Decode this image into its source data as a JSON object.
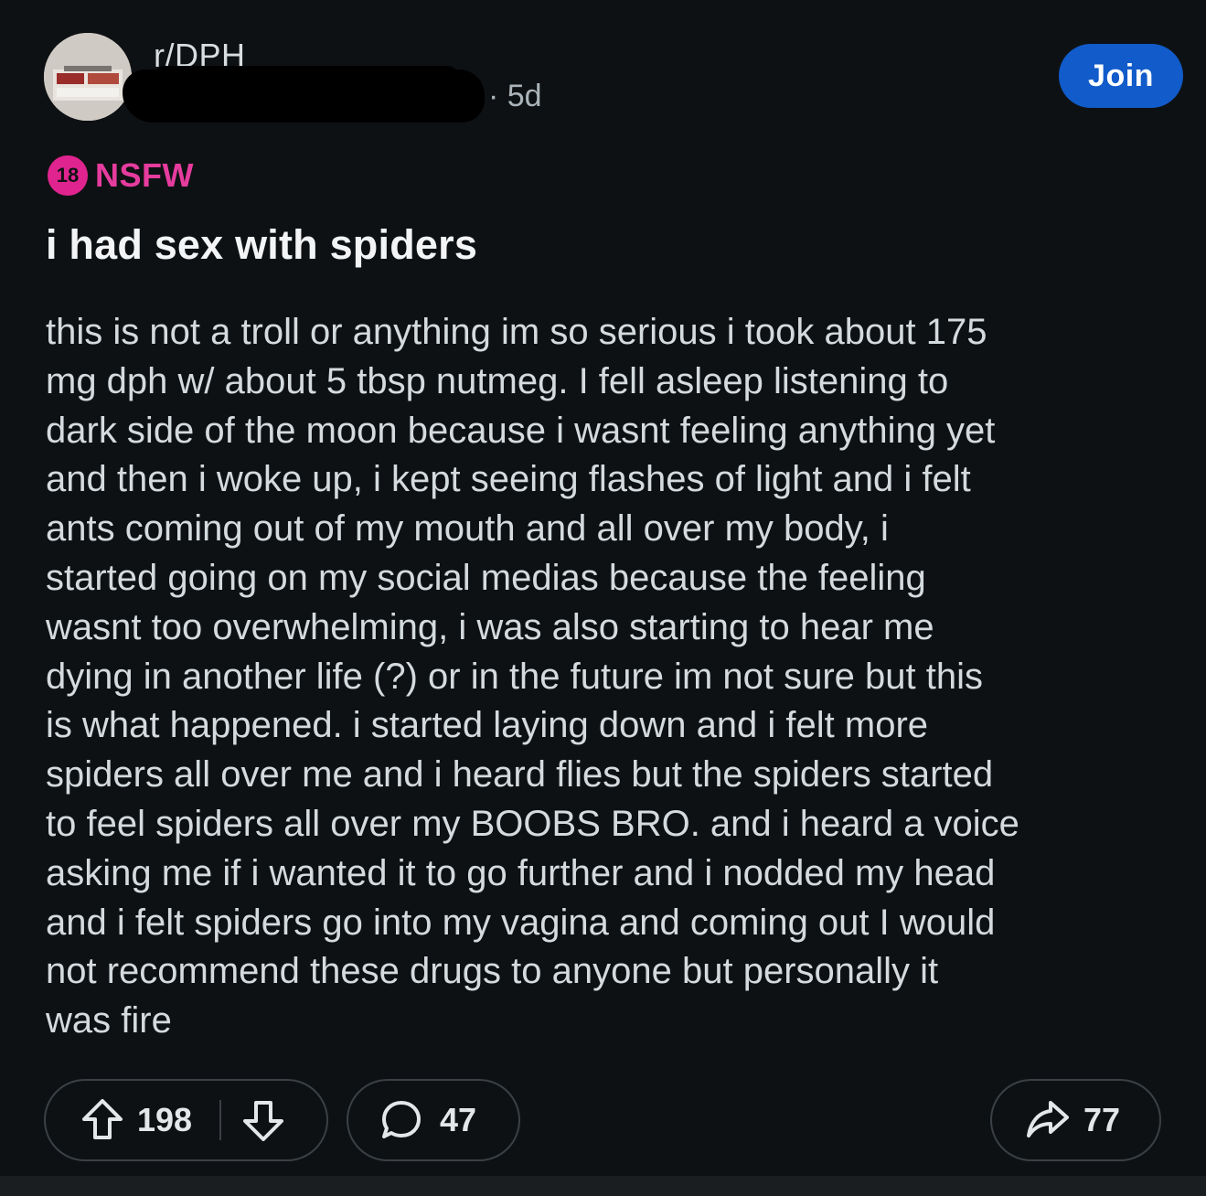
{
  "header": {
    "subreddit": "r/DPH",
    "separator_and_age": "· 5d",
    "join_label": "Join"
  },
  "post": {
    "nsfw_badge_number": "18",
    "nsfw_label": "NSFW",
    "title": "i had sex with spiders",
    "body": "this is not a troll or anything im so serious i took about 175\nmg dph w/ about 5 tbsp nutmeg. I fell asleep listening to\ndark side of the moon because i wasnt feeling anything yet\nand then i woke up, i kept seeing flashes of light and i felt\nants coming out of my mouth and all over my body, i\nstarted going on my social medias because the feeling\nwasnt too overwhelming, i was also starting to hear me\ndying in another life (?) or in the future im not sure but this\nis what happened. i started laying down and i felt more\nspiders all over me and i heard flies but the spiders started\nto feel spiders all over my BOOBS BRO. and i heard a voice\nasking me if i wanted it to go further and i nodded my head\nand i felt spiders go into my vagina and coming out I would\nnot recommend these drugs to anyone but personally it\nwas fire"
  },
  "actions": {
    "upvotes": "198",
    "comments": "47",
    "shares": "77"
  },
  "icons": {
    "upvote": "arrow-up-outline-icon",
    "downvote": "arrow-down-outline-icon",
    "comment": "speech-bubble-icon",
    "share": "share-arrow-icon"
  },
  "colors": {
    "background": "#0e1113",
    "join_button": "#115bca",
    "nsfw": "#e0248f"
  }
}
